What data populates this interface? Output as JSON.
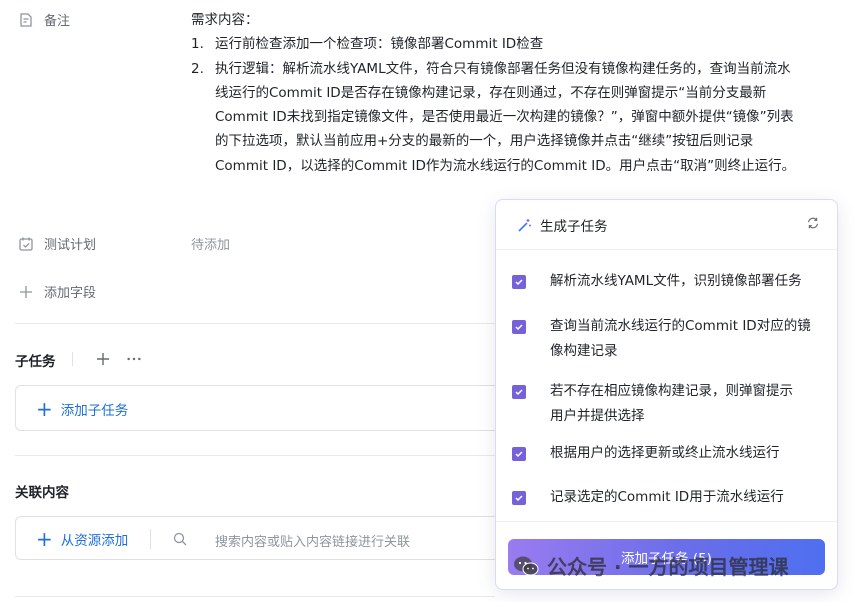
{
  "fields": {
    "remark_label": "备注",
    "description_heading": "需求内容：",
    "description_items": [
      {
        "num": "1.",
        "text": "运行前检查添加一个检查项：镜像部署Commit ID检查"
      },
      {
        "num": "2.",
        "text": "执行逻辑：解析流水线YAML文件，符合只有镜像部署任务但没有镜像构建任务的，查询当前流水线运行的Commit ID是否存在镜像构建记录，存在则通过，不存在则弹窗提示“当前分支最新Commit ID未找到指定镜像文件，是否使用最近一次构建的镜像？”，弹窗中额外提供“镜像”列表的下拉选项，默认当前应用+分支的最新的一个，用户选择镜像并点击“继续”按钮后则记录Commit ID，以选择的Commit ID作为流水线运行的Commit ID。用户点击“取消”则终止运行。"
      }
    ],
    "test_plan_label": "测试计划",
    "test_plan_value": "待添加",
    "add_field_label": "添加字段"
  },
  "subtasks": {
    "title": "子任务",
    "add_label": "添加子任务"
  },
  "related": {
    "title": "关联内容",
    "add_from_resource": "从资源添加",
    "search_placeholder": "搜索内容或贴入内容链接进行关联"
  },
  "popup": {
    "title": "生成子任务",
    "tasks": [
      {
        "text": "解析流水线YAML文件，识别镜像部署任务",
        "checked": true
      },
      {
        "text": "查询当前流水线运行的Commit ID对应的镜像构建记录",
        "checked": true
      },
      {
        "text": "若不存在相应镜像构建记录，则弹窗提示用户并提供选择",
        "checked": true
      },
      {
        "text": "根据用户的选择更新或终止流水线运行",
        "checked": true
      },
      {
        "text": "记录选定的Commit ID用于流水线运行",
        "checked": true
      }
    ],
    "button_label": "添加子任务 (5)"
  },
  "watermark": {
    "text": "公众号 · 一方的项目管理课"
  },
  "colors": {
    "accent": "#1e6fd9",
    "checkbox": "#7463d8",
    "button_gradient_start": "#9a7bf0",
    "button_gradient_end": "#4f6ff0"
  }
}
